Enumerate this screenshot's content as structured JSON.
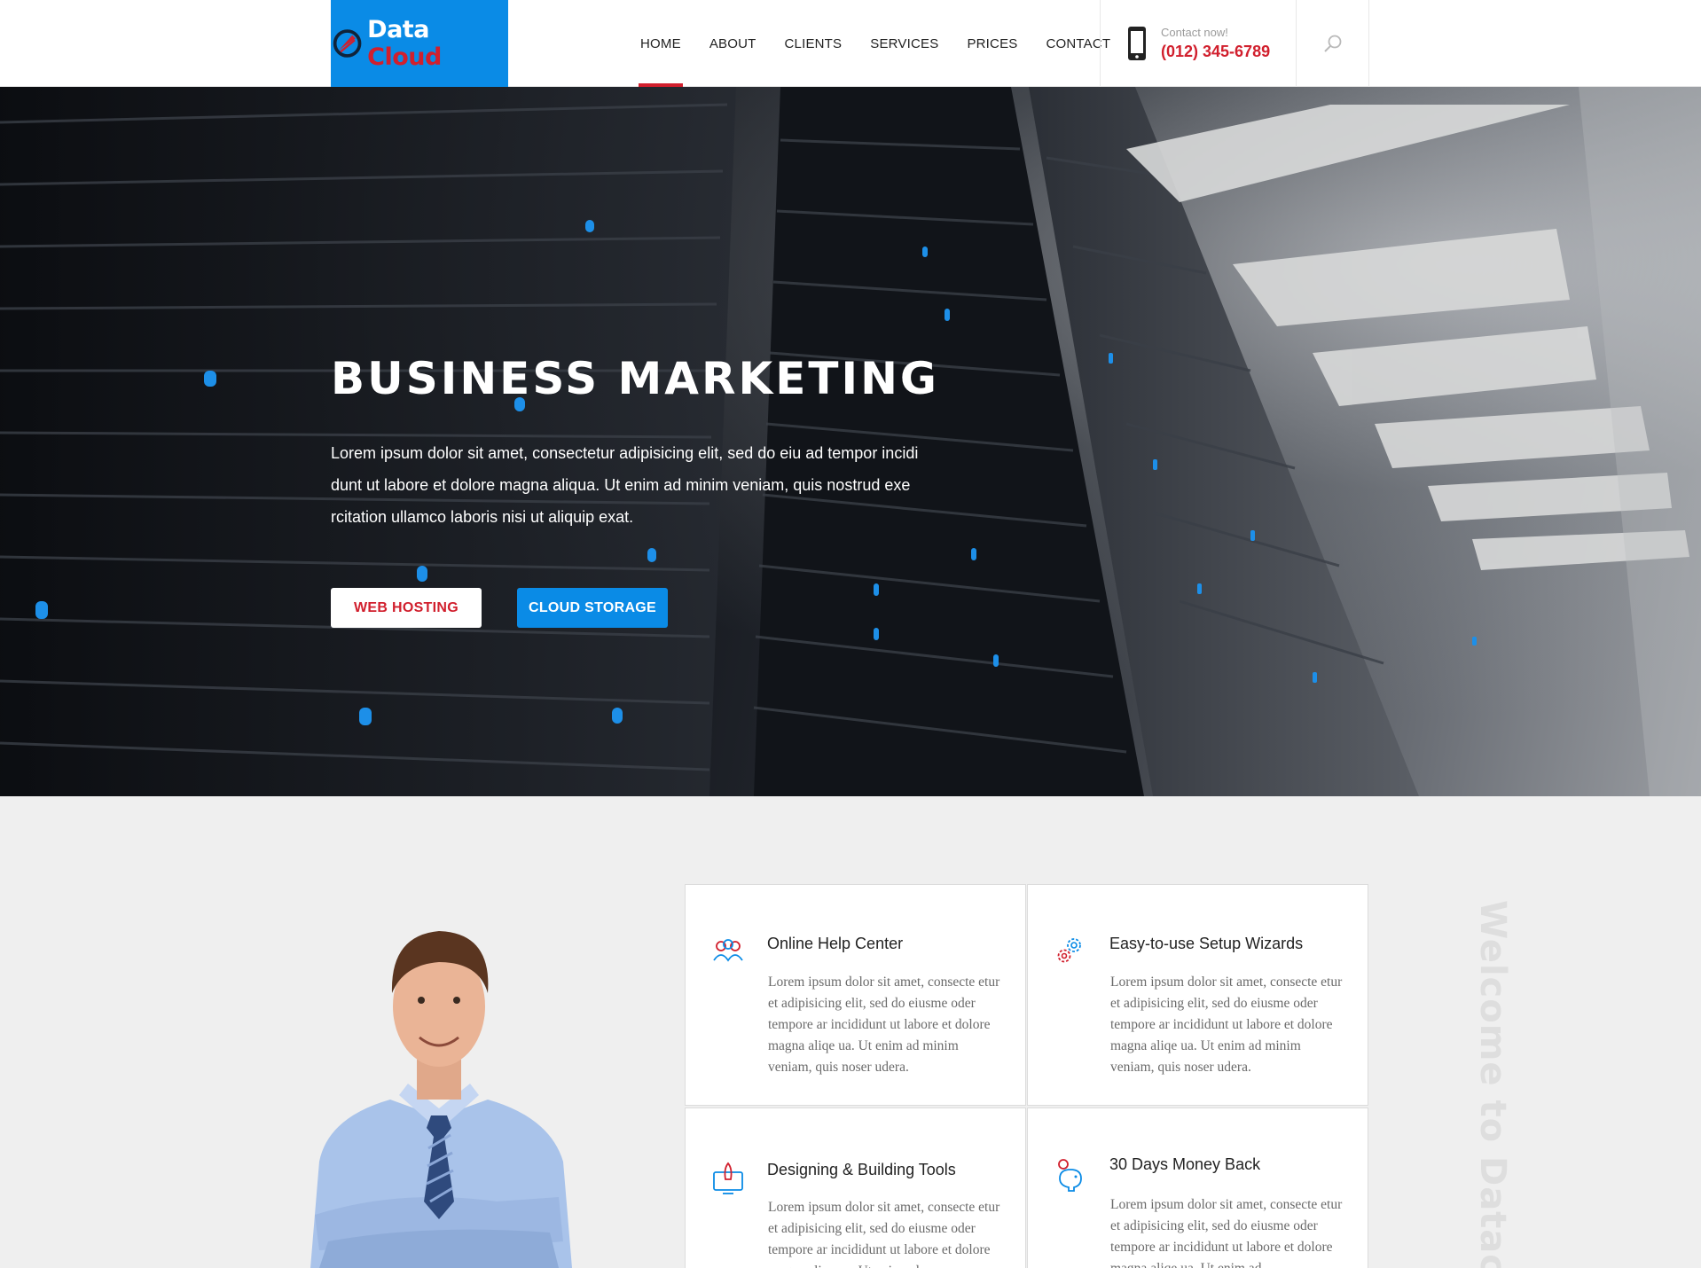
{
  "brand": {
    "name_part1": "Data",
    "name_part2": "Cloud",
    "blue": "#0a8be6",
    "red": "#d11f2d"
  },
  "nav": {
    "items": [
      "HOME",
      "ABOUT",
      "CLIENTS",
      "SERVICES",
      "PRICES",
      "CONTACT"
    ],
    "active": "HOME"
  },
  "contact": {
    "label": "Contact now!",
    "number": "(012) 345-6789",
    "icon": "mobile-phone-icon"
  },
  "search": {
    "icon": "search-icon"
  },
  "hero": {
    "title": "BUSINESS MARKETING",
    "text": "Lorem ipsum dolor sit amet, consectetur adipisicing elit, sed do eiu ad tempor incidi dunt ut labore et dolore magna aliqua. Ut enim ad minim veniam, quis nostrud exe rcitation ullamco laboris nisi ut aliquip exat.",
    "button_primary": "WEB HOSTING",
    "button_secondary": "CLOUD STORAGE"
  },
  "features": [
    {
      "title": "Online Help Center",
      "icon": "users-icon",
      "text": "Lorem ipsum dolor sit amet, consecte etur et adipisicing elit, sed do eiusme oder  tempore ar incididunt ut labore et dolore magna aliqe ua. Ut enim ad minim veniam, quis noser udera."
    },
    {
      "title": "Easy-to-use Setup Wizards",
      "icon": "gears-icon",
      "text": "Lorem ipsum dolor sit amet, consecte etur et adipisicing elit, sed do eiusme oder  tempore ar incididunt ut labore et dolore magna aliqe ua. Ut enim ad minim veniam, quis noser udera."
    },
    {
      "title": "Designing & Building Tools",
      "icon": "rocket-monitor-icon",
      "text": "Lorem ipsum dolor sit amet, consecte etur et adipisicing elit, sed do eiusme oder  tempore ar incididunt ut labore et dolore magna aliqe ua. Ut enim ad"
    },
    {
      "title": "30 Days Money Back",
      "icon": "piggy-bank-icon",
      "text": "Lorem ipsum dolor sit amet, consecte etur et adipisicing elit, sed do eiusme oder  tempore ar incididunt ut labore et dolore magna aliqe ua. Ut enim ad"
    }
  ],
  "side_text": "Welcome to Datacloud"
}
